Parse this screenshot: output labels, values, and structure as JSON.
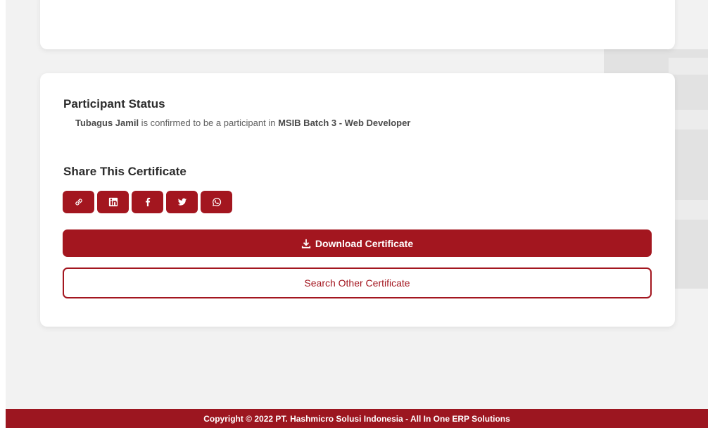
{
  "participant_status": {
    "title": "Participant Status",
    "participant_name": "Tubagus Jamil",
    "confirm_text": " is confirmed to be a participant in ",
    "program": "MSIB Batch 3 - Web Developer"
  },
  "share": {
    "title": "Share This Certificate",
    "buttons": [
      {
        "icon": "link-icon"
      },
      {
        "icon": "linkedin-icon"
      },
      {
        "icon": "facebook-icon"
      },
      {
        "icon": "twitter-icon"
      },
      {
        "icon": "whatsapp-icon"
      }
    ]
  },
  "actions": {
    "download_label": "Download Certificate",
    "download_icon": "download-icon",
    "search_label": "Search Other Certificate"
  },
  "footer": {
    "copyright": "Copyright © 2022 PT. Hashmicro Solusi Indonesia - All In One ERP Solutions"
  },
  "colors": {
    "brand": "#a3161f",
    "footer_bg": "#9c1620",
    "page_bg": "#f2f2f2",
    "card_bg": "#ffffff"
  }
}
